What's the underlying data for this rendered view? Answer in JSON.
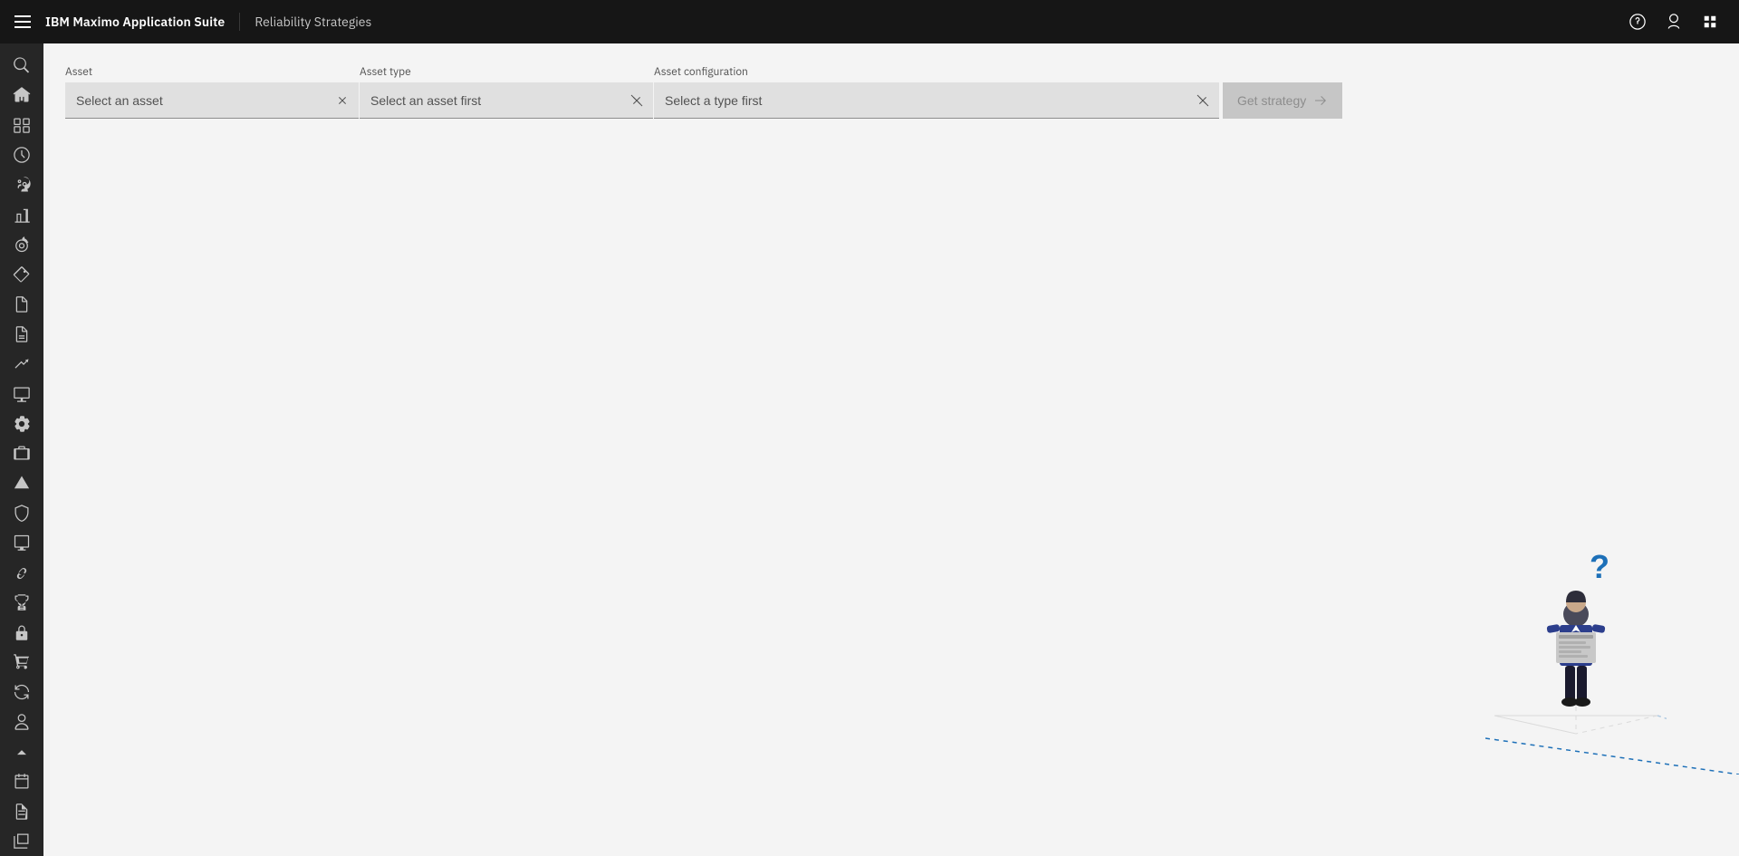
{
  "topbar": {
    "menu_label": "Menu",
    "app_name": "IBM Maximo Application Suite",
    "page_title": "Reliability Strategies",
    "help_icon": "?",
    "user_icon": "👤",
    "apps_icon": "⊞"
  },
  "sidebar": {
    "items": [
      {
        "name": "search",
        "icon": "search"
      },
      {
        "name": "home",
        "icon": "home"
      },
      {
        "name": "reports",
        "icon": "grid"
      },
      {
        "name": "history",
        "icon": "history"
      },
      {
        "name": "team",
        "icon": "team"
      },
      {
        "name": "chart",
        "icon": "chart"
      },
      {
        "name": "target",
        "icon": "target"
      },
      {
        "name": "tag",
        "icon": "tag"
      },
      {
        "name": "report1",
        "icon": "report1"
      },
      {
        "name": "report2",
        "icon": "report2"
      },
      {
        "name": "trending",
        "icon": "trending"
      },
      {
        "name": "monitor",
        "icon": "monitor"
      },
      {
        "name": "settings-wheel",
        "icon": "settings-wheel"
      },
      {
        "name": "briefcase",
        "icon": "briefcase"
      },
      {
        "name": "alert",
        "icon": "alert"
      },
      {
        "name": "shield",
        "icon": "shield"
      },
      {
        "name": "display",
        "icon": "display"
      },
      {
        "name": "link",
        "icon": "link"
      },
      {
        "name": "trophy",
        "icon": "trophy"
      },
      {
        "name": "lock",
        "icon": "lock"
      },
      {
        "name": "cart",
        "icon": "cart"
      },
      {
        "name": "refresh",
        "icon": "refresh"
      },
      {
        "name": "users2",
        "icon": "users2"
      },
      {
        "name": "arrow-up",
        "icon": "arrow-up"
      },
      {
        "name": "calendar-check",
        "icon": "calendar-check"
      },
      {
        "name": "doc1",
        "icon": "doc1"
      },
      {
        "name": "doc2",
        "icon": "doc2"
      }
    ]
  },
  "filters": {
    "asset_label": "Asset",
    "asset_placeholder": "Select an asset",
    "asset_type_label": "Asset type",
    "asset_type_placeholder": "Select an asset first",
    "asset_config_label": "Asset configuration",
    "asset_config_placeholder": "Select a type first",
    "get_strategy_label": "Get strategy"
  }
}
